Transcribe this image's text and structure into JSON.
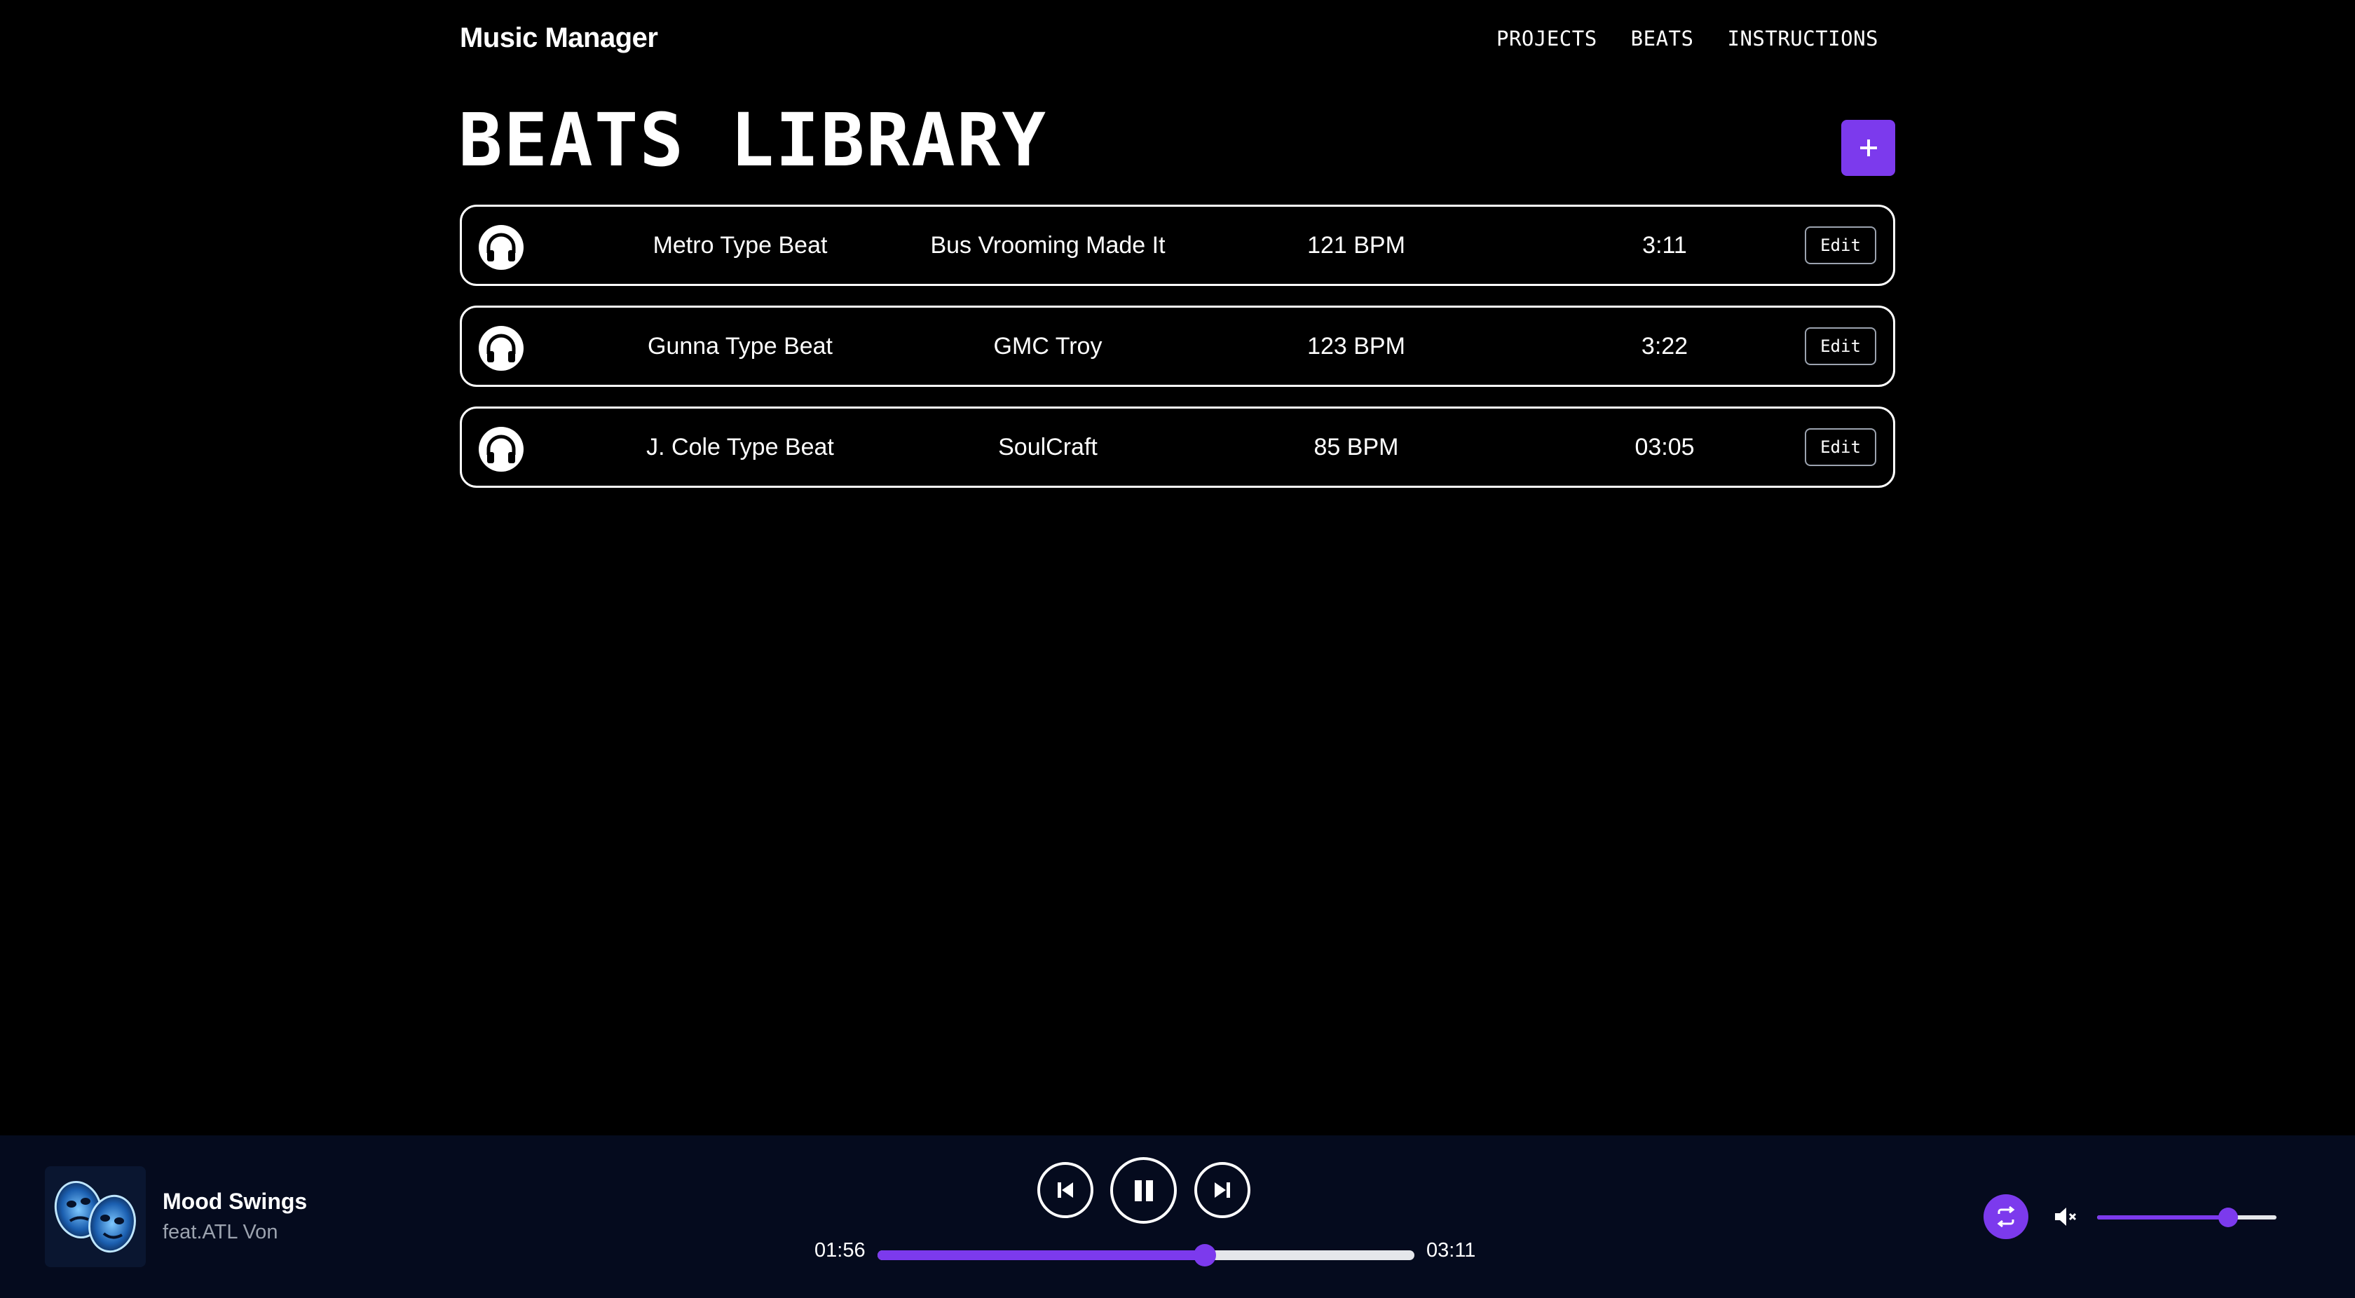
{
  "app": {
    "brand": "Music Manager"
  },
  "nav": {
    "projects": "PROJECTS",
    "beats": "BEATS",
    "instructions": "INSTRUCTIONS"
  },
  "page": {
    "title": "BEATS LIBRARY",
    "add_icon": "plus-icon"
  },
  "beats": [
    {
      "name": "Metro Type Beat",
      "producer": "Bus Vrooming Made It",
      "bpm": "121 BPM",
      "duration": "3:11",
      "edit": "Edit",
      "icon": "headphones-icon"
    },
    {
      "name": "Gunna Type Beat",
      "producer": "GMC Troy",
      "bpm": "123 BPM",
      "duration": "3:22",
      "edit": "Edit",
      "icon": "headphones-icon"
    },
    {
      "name": "J. Cole Type Beat",
      "producer": "SoulCraft",
      "bpm": "85 BPM",
      "duration": "03:05",
      "edit": "Edit",
      "icon": "headphones-icon"
    }
  ],
  "player": {
    "track_title": "Mood Swings",
    "track_artist": "feat.ATL Von",
    "current_time": "01:56",
    "total_time": "03:11",
    "progress_fraction": 0.61,
    "volume_fraction": 0.73,
    "icons": {
      "prev": "skip-back-icon",
      "pause": "pause-icon",
      "next": "skip-forward-icon",
      "repeat": "repeat-icon",
      "mute": "volume-mute-icon"
    }
  },
  "colors": {
    "accent": "#7c3aed",
    "background": "#000000",
    "player_bg": "#050b1e",
    "muted_text": "#9ca3af"
  }
}
